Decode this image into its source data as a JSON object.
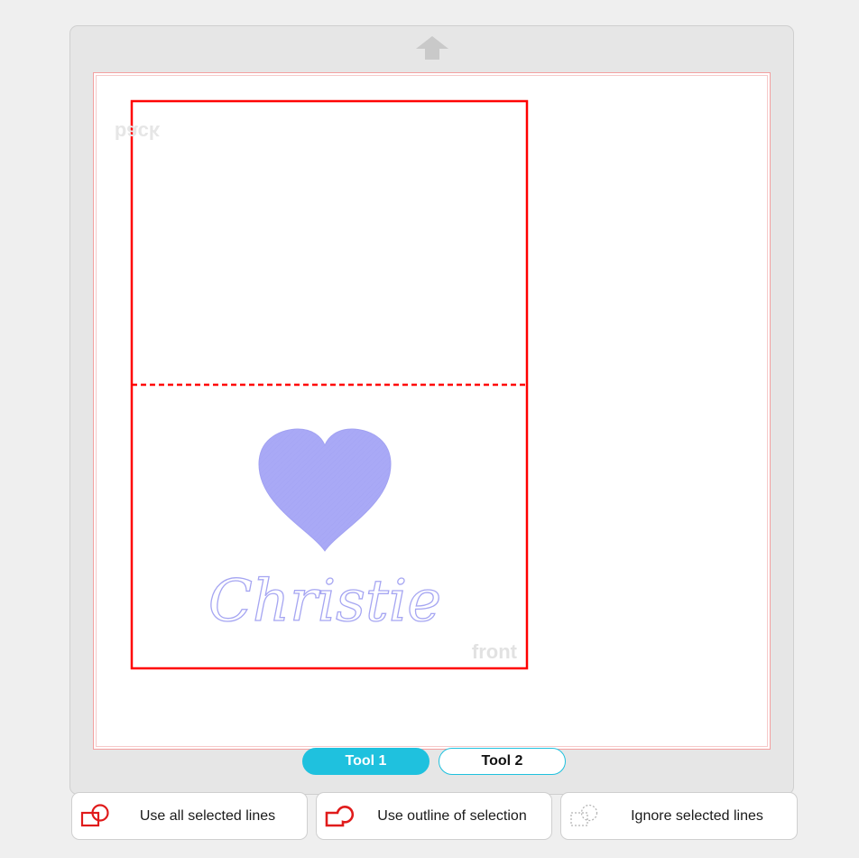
{
  "canvas": {
    "back_label": "back",
    "front_label": "front",
    "script_text": "Christie"
  },
  "tools": {
    "tab1": "Tool 1",
    "tab2": "Tool 2"
  },
  "actions": {
    "use_all": "Use all selected lines",
    "use_outline": "Use outline of selection",
    "ignore": "Ignore selected lines"
  },
  "colors": {
    "accent": "#1fc1de",
    "cut_line": "#ff0000",
    "heart_fill": "#a9a9f6",
    "panel": "#e6e6e6"
  },
  "icons": [
    "arrow-up-icon",
    "shapes-selected-icon",
    "shapes-outline-icon",
    "shapes-ignore-icon"
  ]
}
